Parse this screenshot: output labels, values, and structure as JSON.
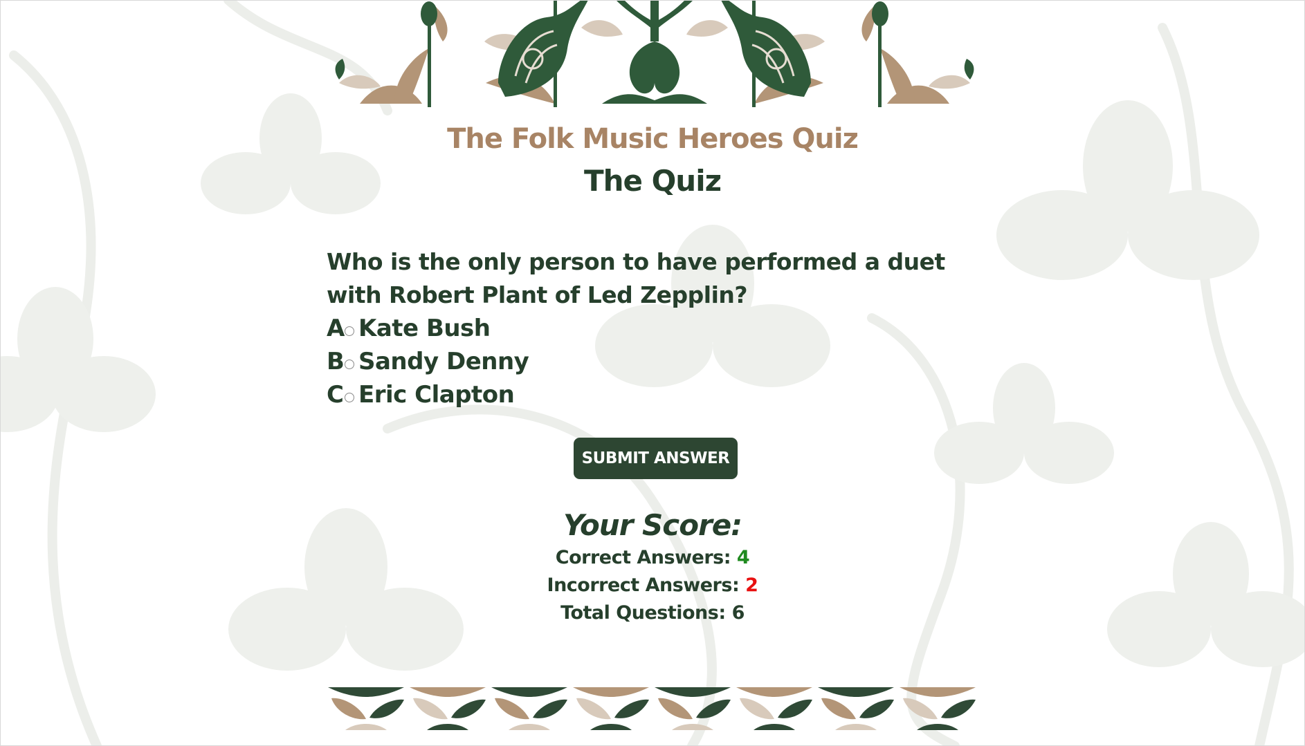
{
  "site_title": "The Folk Music Heroes Quiz",
  "page_title": "The Quiz",
  "question": {
    "text": "Who is the only person to have performed a duet with Robert Plant of Led Zepplin?",
    "options": [
      {
        "letter": "A",
        "label": "Kate Bush"
      },
      {
        "letter": "B",
        "label": "Sandy Denny"
      },
      {
        "letter": "C",
        "label": "Eric Clapton"
      }
    ]
  },
  "submit_label": "SUBMIT ANSWER",
  "score": {
    "title": "Your Score:",
    "correct_label": "Correct Answers:",
    "correct_value": "4",
    "incorrect_label": "Incorrect Answers:",
    "incorrect_value": "2",
    "total_label": "Total Questions:",
    "total_value": "6"
  },
  "colors": {
    "dark_green": "#2d4632",
    "tan": "#a88465",
    "correct": "#1f8a1f",
    "incorrect": "#e81010"
  }
}
